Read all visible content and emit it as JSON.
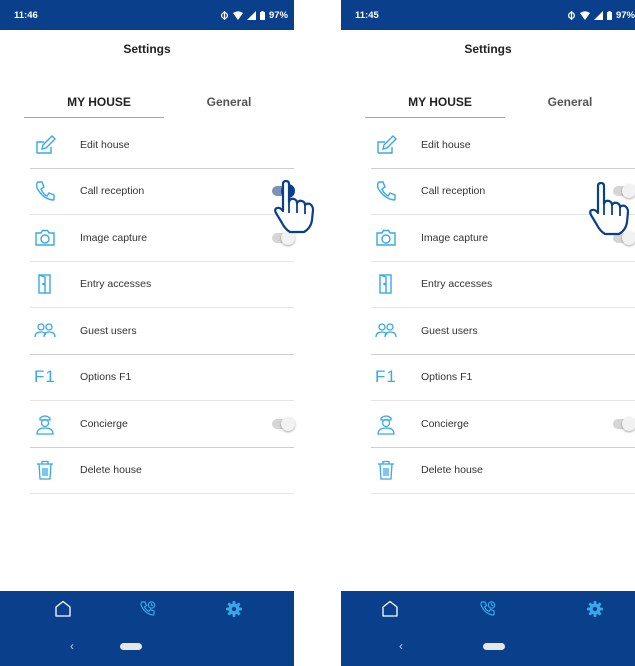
{
  "colors": {
    "brand_blue": "#0a3f8c",
    "accent_blue": "#37a9e8",
    "tab_underline": "#4fc3f7"
  },
  "screens": [
    {
      "status": {
        "time": "11:46",
        "battery": "97%"
      },
      "title": "Settings",
      "tabs": [
        {
          "label": "MY HOUSE",
          "active": true
        },
        {
          "label": "General",
          "active": false
        }
      ],
      "menu": [
        {
          "label": "Edit house",
          "icon": "edit-icon"
        },
        {
          "label": "Call reception",
          "icon": "phone-icon",
          "toggle": "on"
        },
        {
          "label": "Image capture",
          "icon": "camera-icon",
          "toggle": "off"
        },
        {
          "label": "Entry accesses",
          "icon": "door-icon"
        },
        {
          "label": "Guest users",
          "icon": "users-icon"
        },
        {
          "label": "Options F1",
          "icon": "f1-icon",
          "icon_text": "F1"
        },
        {
          "label": "Concierge",
          "icon": "concierge-icon",
          "toggle": "off"
        },
        {
          "label": "Delete house",
          "icon": "trash-icon"
        }
      ],
      "nav": [
        "home-icon",
        "call-history-icon",
        "settings-icon"
      ]
    },
    {
      "status": {
        "time": "11:45",
        "battery": "97%"
      },
      "title": "Settings",
      "tabs": [
        {
          "label": "MY HOUSE",
          "active": true
        },
        {
          "label": "General",
          "active": false
        }
      ],
      "menu": [
        {
          "label": "Edit house",
          "icon": "edit-icon"
        },
        {
          "label": "Call reception",
          "icon": "phone-icon",
          "toggle": "off"
        },
        {
          "label": "Image capture",
          "icon": "camera-icon",
          "toggle": "off"
        },
        {
          "label": "Entry accesses",
          "icon": "door-icon"
        },
        {
          "label": "Guest users",
          "icon": "users-icon"
        },
        {
          "label": "Options F1",
          "icon": "f1-icon",
          "icon_text": "F1"
        },
        {
          "label": "Concierge",
          "icon": "concierge-icon",
          "toggle": "off"
        },
        {
          "label": "Delete house",
          "icon": "trash-icon"
        }
      ],
      "nav": [
        "home-icon",
        "call-history-icon",
        "settings-icon"
      ]
    }
  ]
}
